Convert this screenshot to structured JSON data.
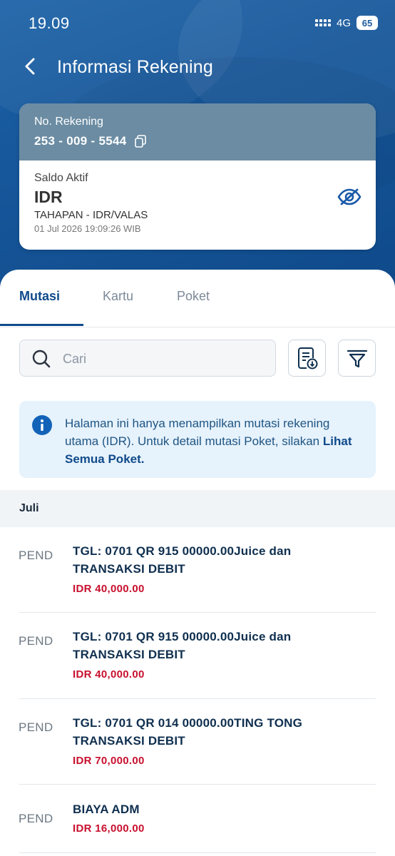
{
  "status_bar": {
    "time": "19.09",
    "network": "4G",
    "battery": "65"
  },
  "app_bar": {
    "title": "Informasi Rekening"
  },
  "account": {
    "number_label": "No. Rekening",
    "number": "253 - 009 - 5544",
    "saldo_label": "Saldo Aktif",
    "currency": "IDR",
    "product": "TAHAPAN - IDR/VALAS",
    "timestamp": "01 Jul 2026 19:09:26 WIB"
  },
  "tabs": [
    {
      "label": "Mutasi",
      "active": true
    },
    {
      "label": "Kartu",
      "active": false
    },
    {
      "label": "Poket",
      "active": false
    }
  ],
  "search": {
    "placeholder": "Cari"
  },
  "info": {
    "text": "Halaman ini hanya menampilkan mutasi rekening utama (IDR). Untuk detail mutasi Poket, silakan ",
    "link": "Lihat Semua Poket."
  },
  "month": "Juli",
  "transactions": [
    {
      "status": "PEND",
      "line1": "TGL: 0701 QR  915 00000.00Juice dan",
      "line2": "TRANSAKSI DEBIT",
      "amount": "IDR 40,000.00"
    },
    {
      "status": "PEND",
      "line1": "TGL: 0701 QR  915 00000.00Juice dan",
      "line2": "TRANSAKSI DEBIT",
      "amount": "IDR 40,000.00"
    },
    {
      "status": "PEND",
      "line1": "TGL: 0701 QR  014 00000.00TING TONG",
      "line2": "TRANSAKSI DEBIT",
      "amount": "IDR 70,000.00"
    },
    {
      "status": "PEND",
      "line1": "BIAYA ADM",
      "line2": "",
      "amount": "IDR 16,000.00"
    }
  ],
  "colors": {
    "primary": "#0f4a8a",
    "amount": "#c8102e",
    "card_header": "#6b8ca3",
    "info_bg": "#e6f2fc"
  }
}
